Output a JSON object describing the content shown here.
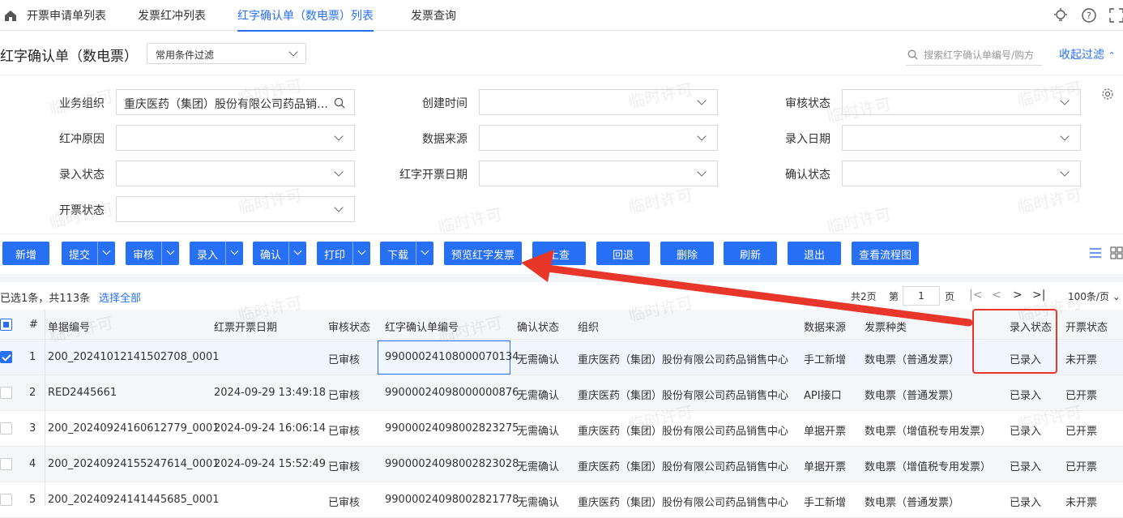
{
  "nav": {
    "tabs": [
      "开票申请单列表",
      "发票红冲列表",
      "红字确认单（数电票）列表",
      "发票查询"
    ],
    "active": 2
  },
  "page": {
    "title": "红字确认单（数电票）",
    "filter_select": "常用条件过滤",
    "search_placeholder": "搜索红字确认单编号/购方",
    "collapse": "收起过滤"
  },
  "filters": {
    "org_label": "业务组织",
    "org_value": "重庆医药（集团）股份有限公司药品销售中心",
    "created_label": "创建时间",
    "review_label": "审核状态",
    "reason_label": "红冲原因",
    "source_label": "数据来源",
    "entry_date_label": "录入日期",
    "entry_status_label": "录入状态",
    "red_date_label": "红字开票日期",
    "confirm_label": "确认状态",
    "invoice_status_label": "开票状态"
  },
  "toolbar": {
    "add": "新增",
    "submit": "提交",
    "audit": "审核",
    "entry": "录入",
    "confirm": "确认",
    "print": "打印",
    "download": "下载",
    "preview": "预览红字发票",
    "lookup": "上查",
    "rollback": "回退",
    "delete": "删除",
    "refresh": "刷新",
    "exit": "退出",
    "flow": "查看流程图"
  },
  "summary": {
    "selected": "已选1条，共113条",
    "select_all": "选择全部",
    "pages": "共2页",
    "page_prefix": "第",
    "page_num": "1",
    "page_suffix": "页",
    "per_page": "100条/页"
  },
  "table": {
    "headers": [
      "#",
      "单据编号",
      "红票开票日期",
      "审核状态",
      "红字确认单编号",
      "确认状态",
      "组织",
      "数据来源",
      "发票种类",
      "录入状态",
      "开票状态"
    ],
    "rows": [
      {
        "n": "1",
        "code": "200_20241012141502708_0001",
        "date": "",
        "audit": "已审核",
        "red_no": "9900002410800007013​4",
        "confirm": "无需确认",
        "org": "重庆医药（集团）股份有限公司药品销售中心",
        "source": "手工新增",
        "kind": "数电票（普通发票）",
        "entry": "已录入",
        "invoice": "未开票"
      },
      {
        "n": "2",
        "code": "RED2445661",
        "date": "2024-09-29 13:49:18",
        "audit": "已审核",
        "red_no": "99000024098000000876",
        "confirm": "无需确认",
        "org": "重庆医药（集团）股份有限公司药品销售中心",
        "source": "API接口",
        "kind": "数电票（普通发票）",
        "entry": "已录入",
        "invoice": "已开票"
      },
      {
        "n": "3",
        "code": "200_20240924160612779_0001",
        "date": "2024-09-24 16:06:14",
        "audit": "已审核",
        "red_no": "99000024098002823275",
        "confirm": "无需确认",
        "org": "重庆医药（集团）股份有限公司药品销售中心",
        "source": "单据开票",
        "kind": "数电票（增值税专用发票）",
        "entry": "已录入",
        "invoice": "已开票"
      },
      {
        "n": "4",
        "code": "200_20240924155247614_0001",
        "date": "2024-09-24 15:52:49",
        "audit": "已审核",
        "red_no": "99000024098002823028",
        "confirm": "无需确认",
        "org": "重庆医药（集团）股份有限公司药品销售中心",
        "source": "单据开票",
        "kind": "数电票（增值税专用发票）",
        "entry": "已录入",
        "invoice": "已开票"
      },
      {
        "n": "5",
        "code": "200_20240924141445685_0001",
        "date": "",
        "audit": "已审核",
        "red_no": "99000024098002821778",
        "confirm": "无需确认",
        "org": "重庆医药（集团）股份有限公司药品销售中心",
        "source": "手工新增",
        "kind": "数电票（普通发票）",
        "entry": "已录入",
        "invoice": "未开票"
      }
    ]
  },
  "watermark": "临时许可",
  "colors": {
    "accent": "#276ff5",
    "annotation": "#e8372a"
  }
}
